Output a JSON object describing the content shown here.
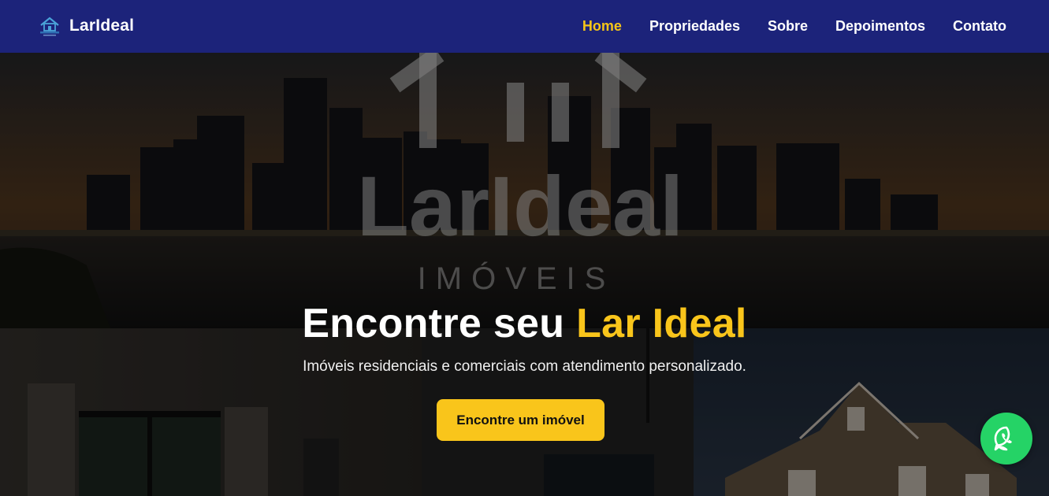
{
  "brand": {
    "name": "LarIdeal",
    "logo_icon": "house-logo-icon"
  },
  "nav": {
    "items": [
      {
        "label": "Home",
        "active": true
      },
      {
        "label": "Propriedades",
        "active": false
      },
      {
        "label": "Sobre",
        "active": false
      },
      {
        "label": "Depoimentos",
        "active": false
      },
      {
        "label": "Contato",
        "active": false
      }
    ]
  },
  "hero": {
    "watermark_title": "LarIdeal",
    "watermark_subtitle": "IMÓVEIS",
    "title_main": "Encontre seu ",
    "title_highlight": "Lar Ideal",
    "subtitle": "Imóveis residenciais e comerciais com atendimento personalizado.",
    "cta_label": "Encontre um imóvel"
  },
  "floating": {
    "whatsapp_icon": "whatsapp-icon"
  },
  "colors": {
    "navbar": "#1c237a",
    "accent": "#f9c51b",
    "whatsapp": "#25d366"
  }
}
